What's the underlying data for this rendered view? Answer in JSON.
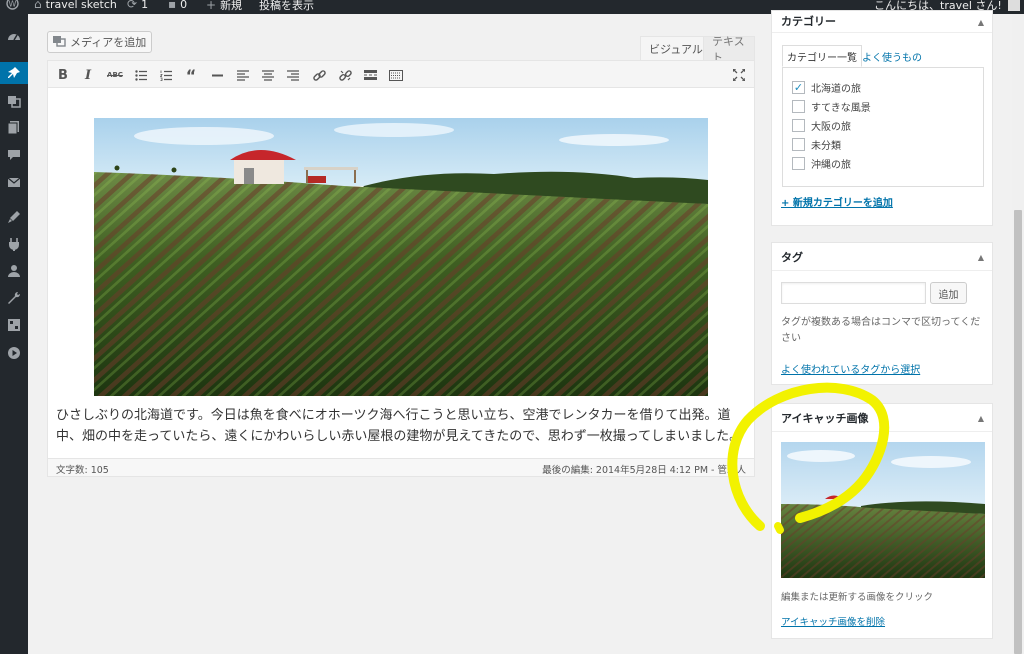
{
  "admin_bar": {
    "site_name": "travel sketch",
    "updates_count": "1",
    "comments_count": "0",
    "new_label": "新規",
    "view_post_label": "投稿を表示",
    "greeting": "こんにちは、travel さん!"
  },
  "admin_menu": {
    "icons": [
      "dashboard-icon",
      "posts-icon",
      "media-icon",
      "pages-icon",
      "comments-icon",
      "feedback-icon",
      "appearance-icon",
      "plugins-icon",
      "users-icon",
      "tools-icon",
      "settings-icon",
      "video-icon"
    ],
    "current": "posts-icon",
    "accent_color": "#0073aa"
  },
  "editor": {
    "add_media_label": "メディアを追加",
    "tab_visual": "ビジュアル",
    "tab_text": "テキスト",
    "toolbar": [
      "bold",
      "italic",
      "strikethrough",
      "bulleted-list",
      "numbered-list",
      "blockquote",
      "horizontal-line",
      "align-left",
      "align-center",
      "align-right",
      "insert-link",
      "remove-link",
      "read-more",
      "toolbar-toggle",
      "fullscreen"
    ],
    "post_text": "ひさしぶりの北海道です。今日は魚を食べにオホーツク海へ行こうと思い立ち、空港でレンタカーを借りて出発。道中、畑の中を走っていたら、遠くにかわいらしい赤い屋根の建物が見えてきたので、思わず一枚撮ってしまいました。",
    "word_count": "文字数: 105",
    "last_edited": "最後の編集: 2014年5月28日 4:12 PM - 管理人"
  },
  "category_box": {
    "title": "カテゴリー",
    "tab_all": "カテゴリー一覧",
    "tab_popular": "よく使うもの",
    "items": [
      {
        "label": "北海道の旅",
        "checked": true
      },
      {
        "label": "すてきな風景",
        "checked": false
      },
      {
        "label": "大阪の旅",
        "checked": false
      },
      {
        "label": "未分類",
        "checked": false
      },
      {
        "label": "沖縄の旅",
        "checked": false
      }
    ],
    "add_new": "+ 新規カテゴリーを追加"
  },
  "tags_box": {
    "title": "タグ",
    "input_value": "",
    "add_button": "追加",
    "hint": "タグが複数ある場合はコンマで区切ってください",
    "choose_popular": "よく使われているタグから選択"
  },
  "featured_image_box": {
    "title": "アイキャッチ画像",
    "hint": "編集または更新する画像をクリック",
    "remove_link": "アイキャッチ画像を削除"
  },
  "annotation": {
    "color": "#f2f200",
    "shape": "hand-drawn circle around featured image box"
  }
}
